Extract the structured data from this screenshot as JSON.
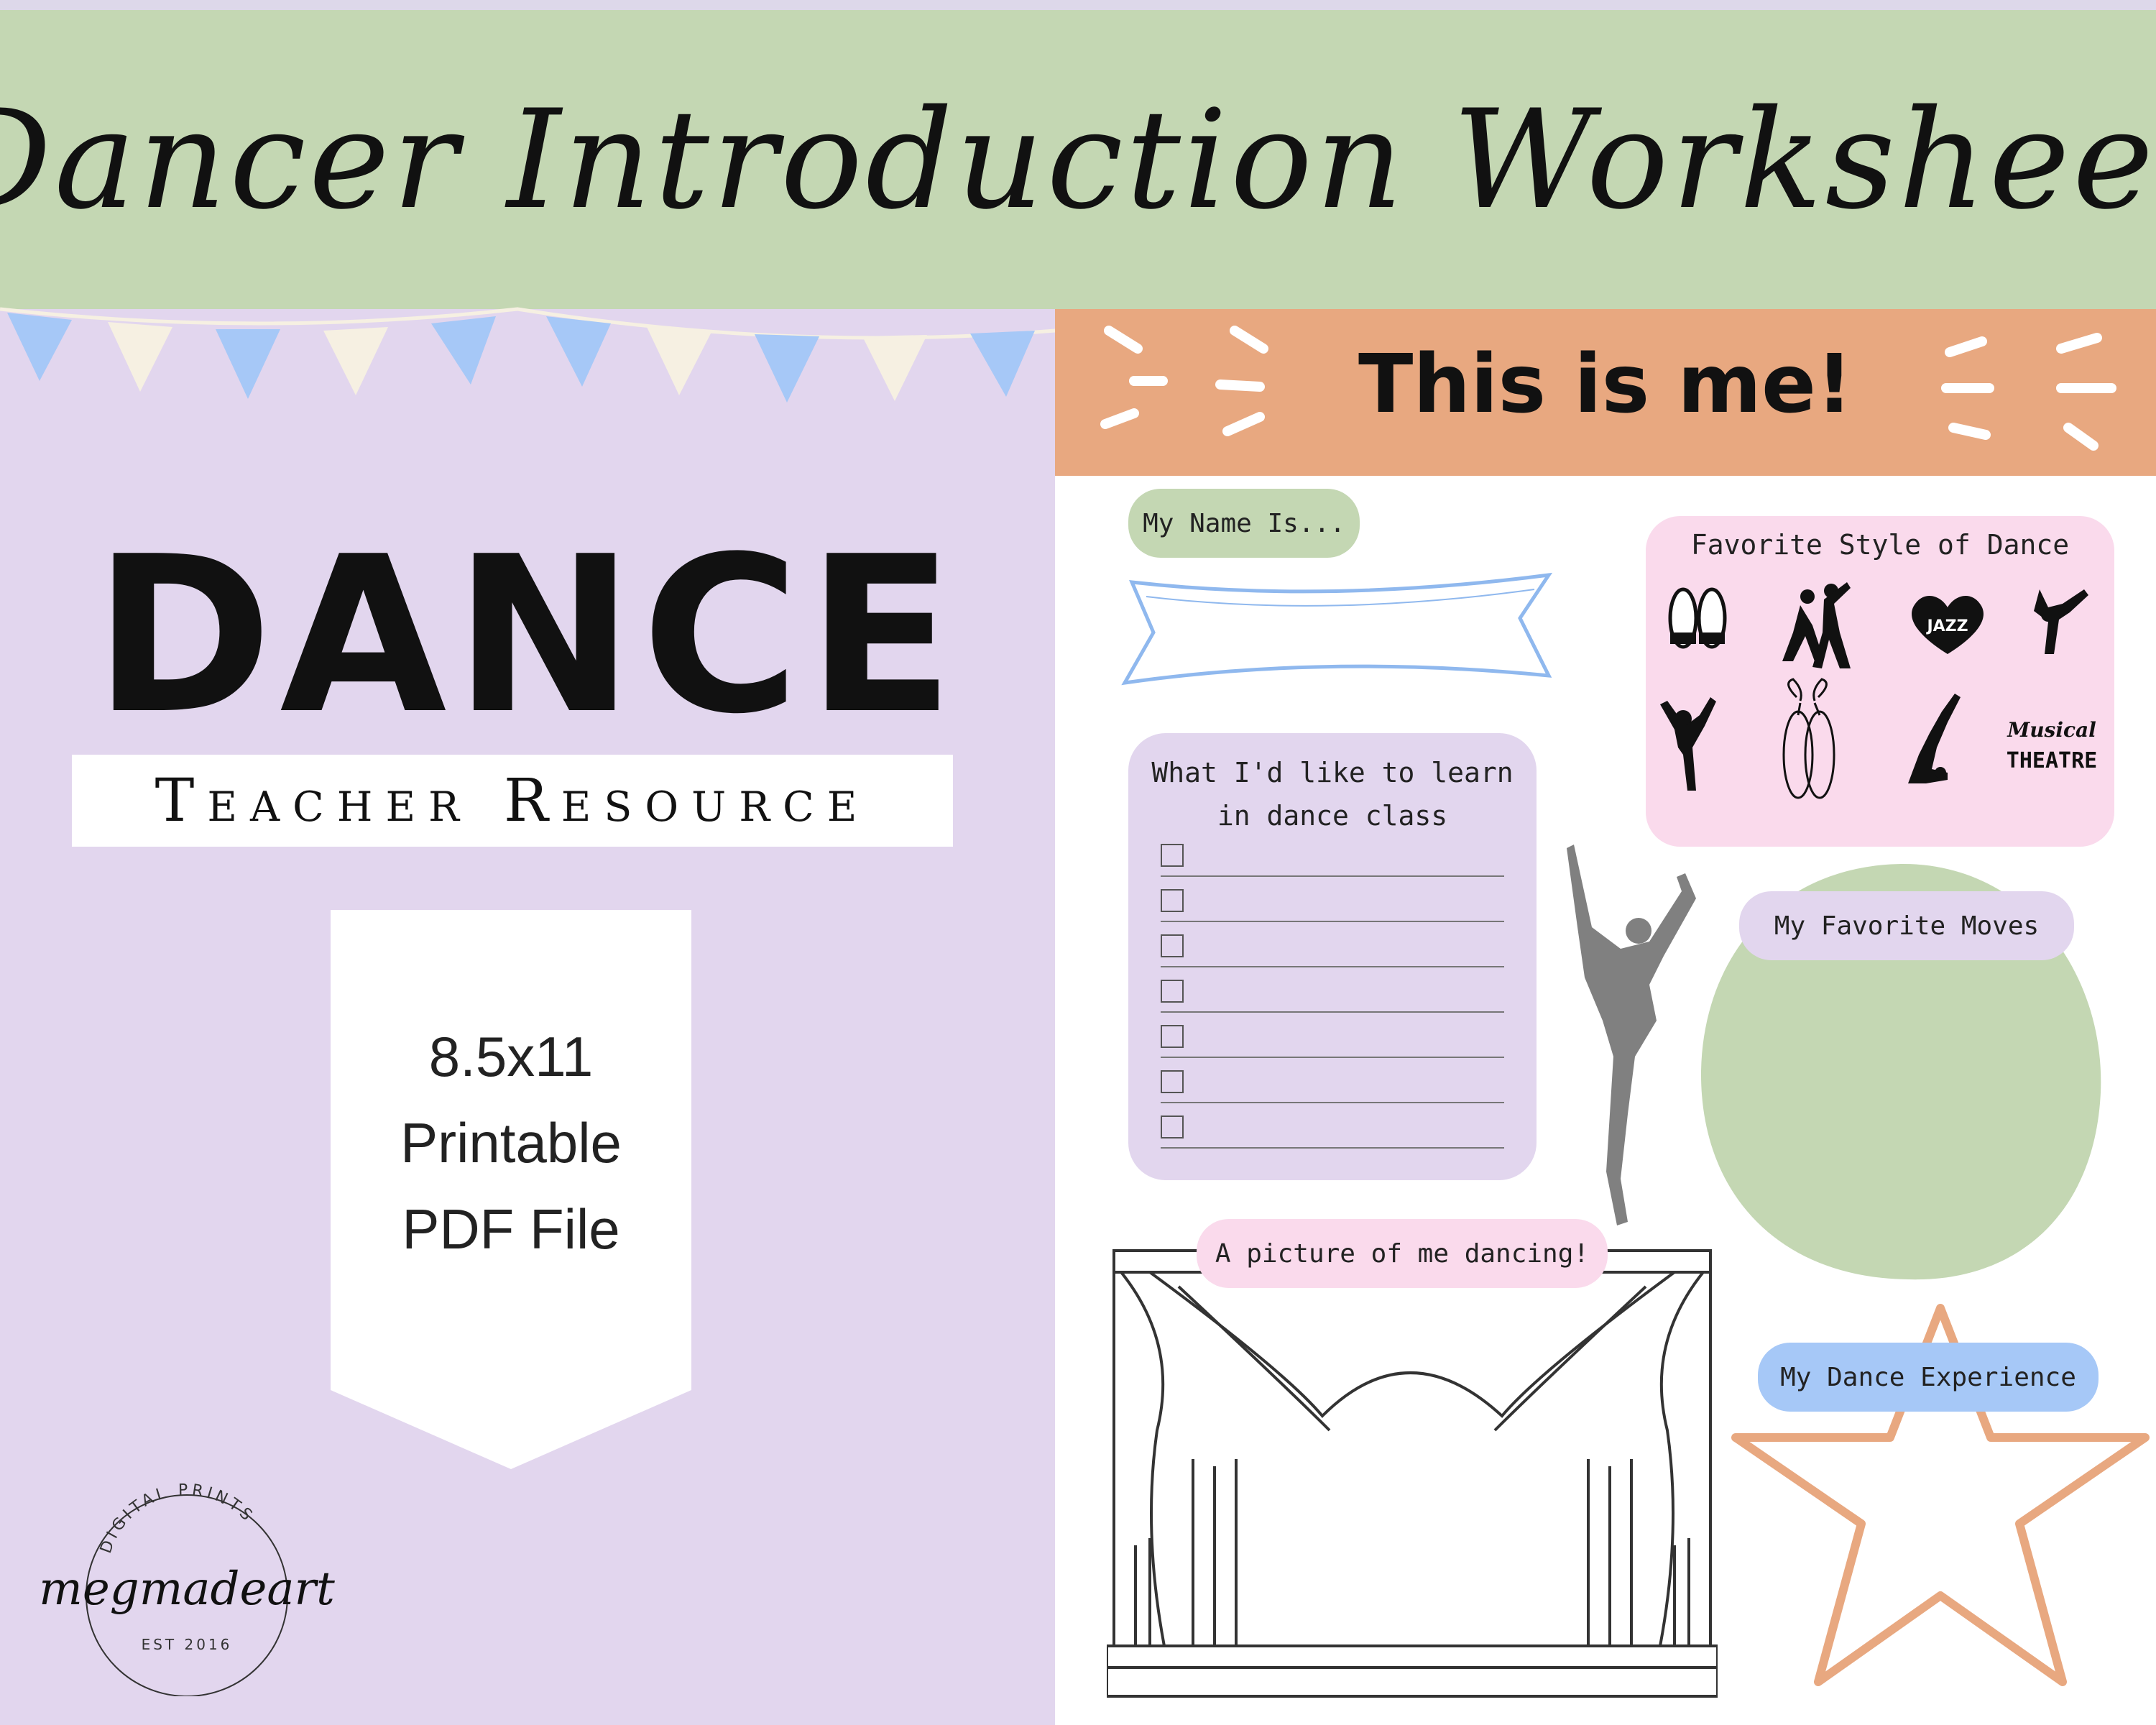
{
  "header": {
    "title": "Dancer Introduction Worksheet"
  },
  "left": {
    "headline": "DANCE",
    "subtitle": "Teacher Resource",
    "pennant_lines": [
      "8.5x11",
      "Printable",
      "PDF File"
    ],
    "logo": {
      "arc_text": "DIGITAL PRINTS",
      "script": "megmadeart",
      "est": "EST 2016"
    }
  },
  "right": {
    "banner": "This is me!",
    "name_label": "My Name Is...",
    "favorite_style": {
      "title": "Favorite Style of Dance",
      "icons": [
        "tap-shoes-icon",
        "ballroom-couple-icon",
        "jazz-heart-icon",
        "breakdance-icon",
        "contemporary-dancer-icon",
        "pointe-shoes-icon",
        "acro-dancer-icon",
        "musical-theatre-icon"
      ],
      "jazz_label": "JAZZ",
      "musical_label": "Musical",
      "theatre_label": "THEATRE"
    },
    "learn": {
      "title_line1": "What I'd like to learn",
      "title_line2": "in dance class",
      "rows": 7
    },
    "moves_label": "My Favorite Moves",
    "picture_label": "A picture of me dancing!",
    "experience_label": "My Dance Experience"
  },
  "colors": {
    "header_green": "#c4d7b3",
    "lavender": "#e2d6ee",
    "peach": "#e8a880",
    "pink": "#fadaec",
    "blue": "#a6c8f7",
    "cream": "#f6f0e2"
  }
}
